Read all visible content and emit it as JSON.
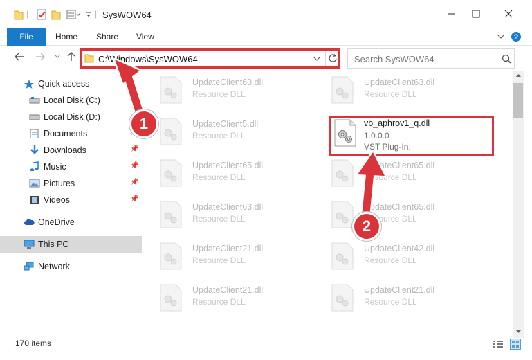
{
  "window": {
    "title": "SysWOW64",
    "min_icon": "minimize-icon",
    "max_icon": "maximize-icon",
    "close_icon": "close-icon"
  },
  "ribbon": {
    "tabs": [
      {
        "label": "File"
      },
      {
        "label": "Home"
      },
      {
        "label": "Share"
      },
      {
        "label": "View"
      }
    ]
  },
  "address": {
    "path": "C:\\Windows\\SysWOW64",
    "search_placeholder": "Search SysWOW64"
  },
  "sidebar": {
    "items": [
      {
        "label": "Quick access",
        "icon": "star-icon"
      },
      {
        "label": "Local Disk (C:)",
        "icon": "drive-icon"
      },
      {
        "label": "Local Disk (D:)",
        "icon": "drive-icon"
      },
      {
        "label": "Documents",
        "icon": "documents-icon"
      },
      {
        "label": "Downloads",
        "icon": "downloads-icon"
      },
      {
        "label": "Music",
        "icon": "music-icon"
      },
      {
        "label": "Pictures",
        "icon": "pictures-icon"
      },
      {
        "label": "Videos",
        "icon": "videos-icon"
      },
      {
        "label": "OneDrive",
        "icon": "cloud-icon"
      },
      {
        "label": "This PC",
        "icon": "computer-icon"
      },
      {
        "label": "Network",
        "icon": "network-icon"
      }
    ]
  },
  "files": [
    {
      "name": "UpdateClient63.dll",
      "type": "Resource DLL"
    },
    {
      "name": "UpdateClient63.dll",
      "type": "Resource DLL"
    },
    {
      "name": "UpdateClient5.dll",
      "type": "Resource DLL"
    },
    {
      "name": "vb_aphrov1_q.dll",
      "type": "1.0.0.0",
      "subtype": "VST Plug-In."
    },
    {
      "name": "UpdateClient65.dll",
      "type": "Resource DLL"
    },
    {
      "name": "UpdateClient65.dll",
      "type": "Resource DLL"
    },
    {
      "name": "UpdateClient63.dll",
      "type": "Resource DLL"
    },
    {
      "name": "UpdateClient65.dll",
      "type": "Resource DLL"
    },
    {
      "name": "UpdateClient21.dll",
      "type": "Resource DLL"
    },
    {
      "name": "UpdateClient42.dll",
      "type": "Resource DLL"
    },
    {
      "name": "UpdateClient21.dll",
      "type": "Resource DLL"
    },
    {
      "name": "UpdateClient21.dll",
      "type": "Resource DLL"
    }
  ],
  "status": {
    "items_count": "170 items"
  },
  "annotations": {
    "step1": "1",
    "step2": "2"
  },
  "colors": {
    "accent": "#1979ca",
    "highlight_red": "#d9343a",
    "selection": "#d9d9d9"
  }
}
